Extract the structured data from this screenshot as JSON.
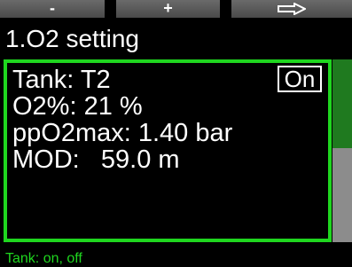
{
  "softkeys": {
    "minus_label": "-",
    "plus_label": "+",
    "next_icon": "right-arrow-icon"
  },
  "title": "1.O2 setting",
  "settings": {
    "tank_line": "Tank: T2",
    "o2_line": "O2%: 21 %",
    "ppo2_line": "ppO2max: 1.40 bar",
    "mod_line": "MOD:   59.0 m",
    "tank_state": "On"
  },
  "scroll": {
    "position_fraction": 0.48
  },
  "hint": "Tank: on, off",
  "colors": {
    "background": "#000000",
    "accent_green": "#1fd61f",
    "scroll_thumb": "#1f7a1f",
    "scroll_track": "#8c8c8c",
    "softkey": "#5a5a5a"
  }
}
